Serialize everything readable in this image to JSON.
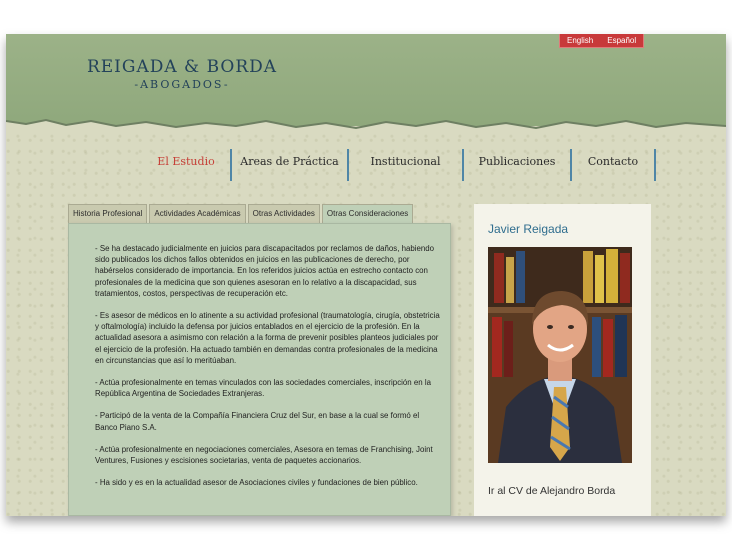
{
  "colors": {
    "header_green": "#93aa80",
    "logo_navy": "#23425a",
    "lang_red": "#c8393a",
    "nav_active": "#c64038",
    "nav_divider": "#4f86a7",
    "panel_green": "#bfd0b7",
    "name_blue": "#2f6d8e"
  },
  "logo": {
    "title": "REIGADA & BORDA",
    "subtitle": "-ABOGADOS-"
  },
  "languages": [
    {
      "label": "English",
      "selected": false
    },
    {
      "label": "Español",
      "selected": true
    }
  ],
  "nav": {
    "active": "El Estudio",
    "items": [
      {
        "label": "El Estudio"
      },
      {
        "label": "Areas de Práctica"
      },
      {
        "label": "Institucional"
      },
      {
        "label": "Publicaciones"
      },
      {
        "label": "Contacto"
      }
    ]
  },
  "tabs": {
    "active": "Otras Consideraciones",
    "items": [
      {
        "label": "Historia Profesional"
      },
      {
        "label": "Actividades Académicas"
      },
      {
        "label": "Otras Actividades"
      },
      {
        "label": "Otras Consideraciones"
      }
    ]
  },
  "content": {
    "paragraphs": [
      "- Se ha destacado judicialmente en juicios para discapacitados por reclamos de daños, habiendo sido publicados los dichos fallos obtenidos en juicios en las publicaciones de derecho, por habérselos considerado de importancia. En los referidos juicios actúa en estrecho contacto con profesionales de la medicina que son quienes asesoran en lo relativo a la discapacidad, sus tratamientos, costos, perspectivas de recuperación etc.",
      "- Es asesor de médicos en lo atinente a su actividad profesional (traumatología, cirugía, obstetricia y oftalmología) incluido la defensa por juicios entablados en el ejercicio de la profesión. En la actualidad asesora a asimismo con relación a la forma de prevenir posibles planteos judiciales por el ejercicio de la profesión. Ha actuado también en demandas contra profesionales de la medicina en circunstancias que así lo meritúaban.",
      "- Actúa profesionalmente en temas vinculados con las sociedades comerciales, inscripción en la República Argentina de Sociedades Extranjeras.",
      "- Participó de la venta de la Compañía Financiera Cruz del Sur, en base a la cual se formó el Banco Piano S.A.",
      "- Actúa profesionalmente en negociaciones comerciales, Asesora en temas de Franchising, Joint Ventures, Fusiones y escisiones societarias, venta de paquetes accionarios.",
      "- Ha sido y es en la actualidad asesor de Asociaciones civiles y fundaciones de bien público."
    ]
  },
  "sidebar": {
    "name": "Javier Reigada",
    "photo_icon": "portrait-photo",
    "cv_link": "Ir al CV de Alejandro Borda"
  }
}
